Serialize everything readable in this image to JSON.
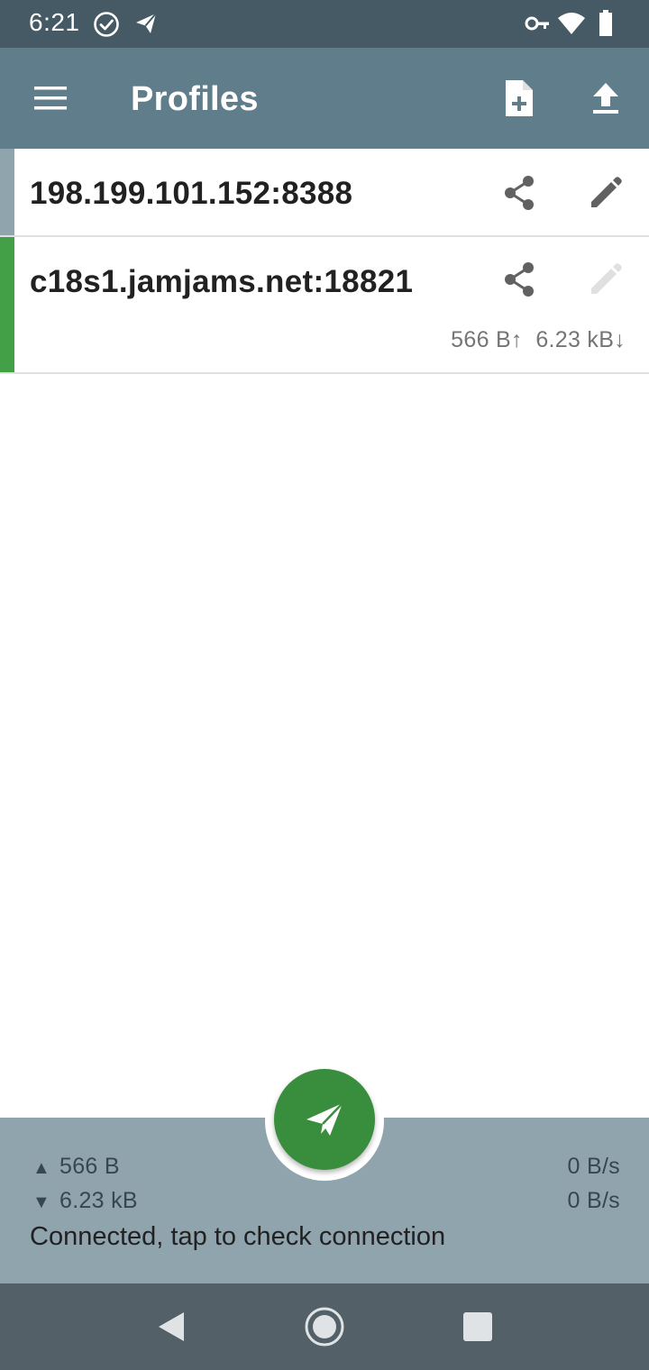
{
  "status_bar": {
    "time": "6:21",
    "icons": [
      "check-circle-icon",
      "send-icon",
      "vpn-key-icon",
      "wifi-icon",
      "battery-icon"
    ]
  },
  "app_bar": {
    "title": "Profiles",
    "icons": [
      "menu-icon",
      "add-file-icon",
      "upload-icon"
    ]
  },
  "profiles": [
    {
      "name": "198.199.101.152:8388",
      "active": false,
      "stripe_color": "#90a4ae"
    },
    {
      "name": "c18s1.jamjams.net:18821",
      "active": true,
      "stripe_color": "#43a047",
      "upload": "566 B↑",
      "download": "6.23 kB↓"
    }
  ],
  "stats": {
    "tx_arrow": "▲",
    "rx_arrow": "▼",
    "tx_total": "566 B",
    "rx_total": "6.23 kB",
    "tx_rate": "0 B/s",
    "rx_rate": "0 B/s",
    "status": "Connected, tap to check connection"
  },
  "colors": {
    "status_bar": "#455a64",
    "app_bar": "#607d8b",
    "fab": "#388e3c",
    "stats_bar": "#90a4ae",
    "nav_bar": "#546067"
  }
}
